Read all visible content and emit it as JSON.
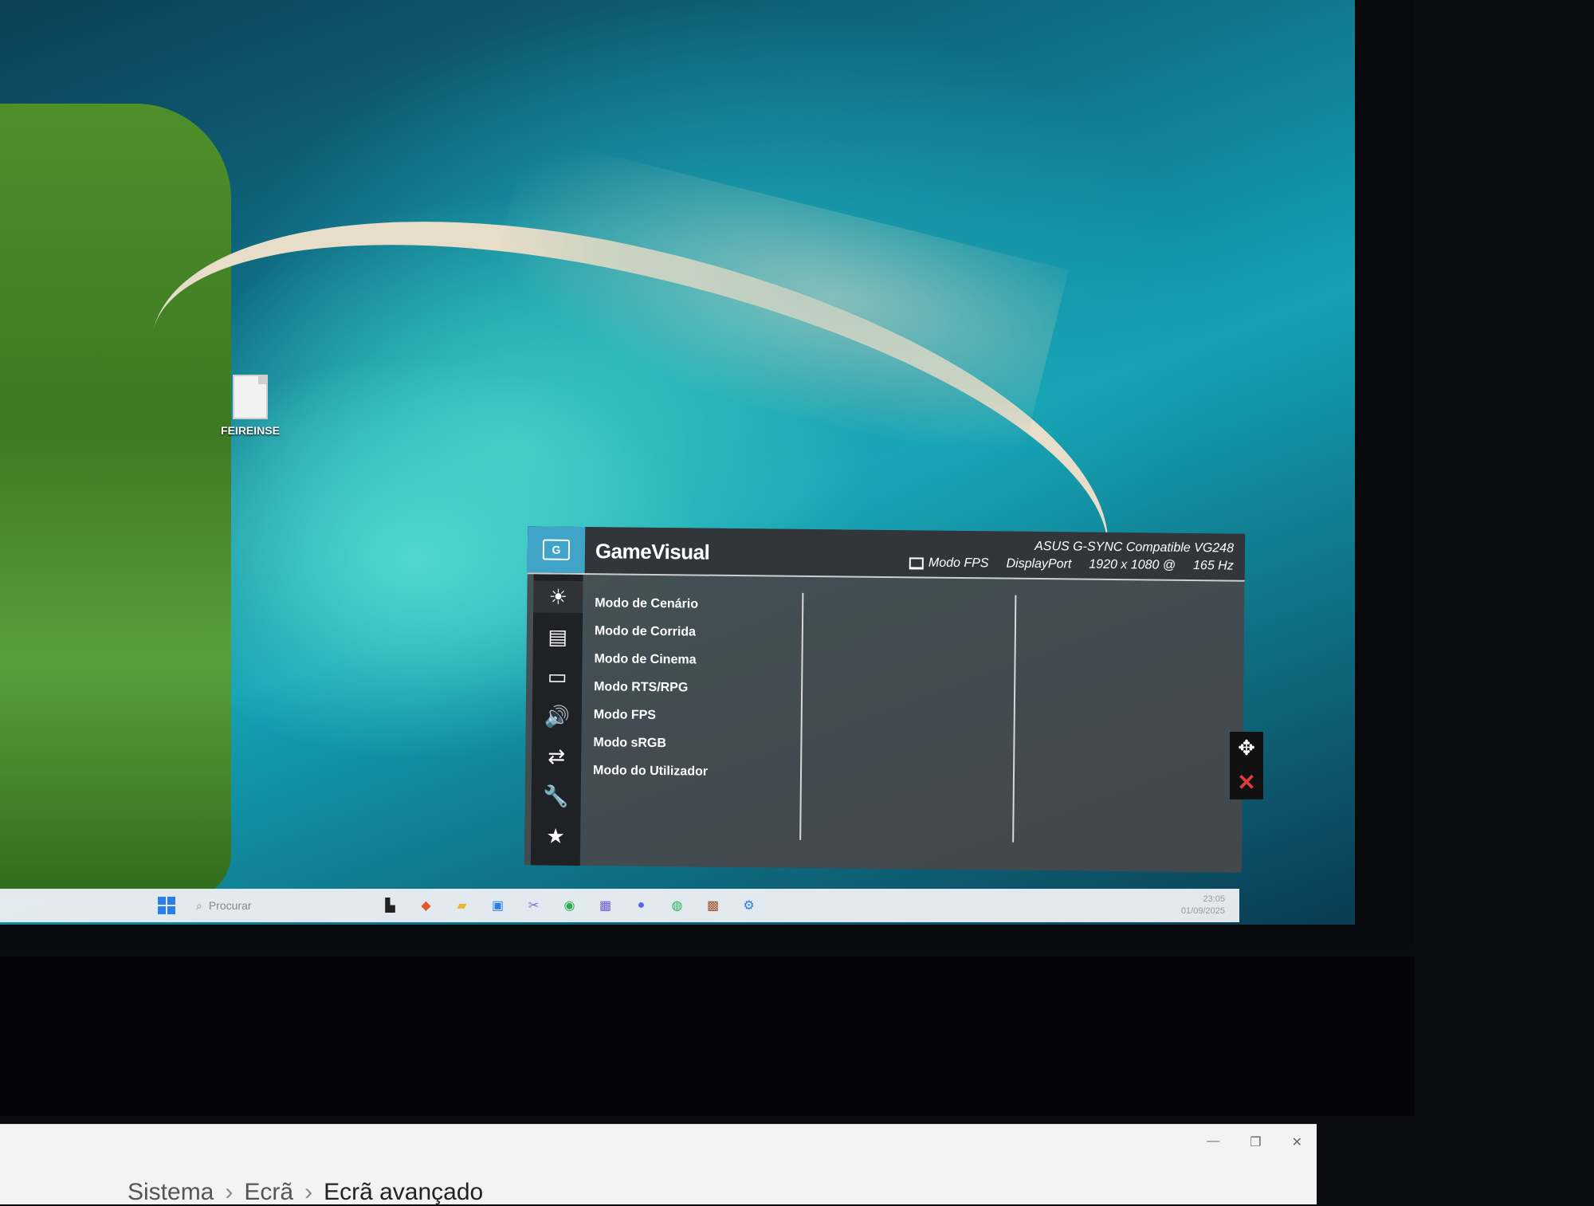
{
  "desktop": {
    "file_label": "FEIREINSE"
  },
  "osd": {
    "title": "GameVisual",
    "model": "ASUS G-SYNC Compatible VG248",
    "current_mode": "Modo FPS",
    "input": "DisplayPort",
    "resolution": "1920 x 1080 @",
    "refresh": "165 Hz",
    "sidebar_icons": [
      "brightness-icon",
      "color-icon",
      "image-icon",
      "sound-icon",
      "input-select-icon",
      "system-setup-icon",
      "my-favorite-icon"
    ],
    "menu_items": [
      "Modo de Cenário",
      "Modo de Corrida",
      "Modo de Cinema",
      "Modo RTS/RPG",
      "Modo FPS",
      "Modo sRGB",
      "Modo do Utilizador"
    ]
  },
  "taskbar": {
    "search_placeholder": "Procurar",
    "time": "23:05",
    "date": "01/09/2025"
  },
  "settings_window": {
    "breadcrumb": [
      "Sistema",
      "Ecrã",
      "Ecrã avançado"
    ]
  },
  "colors": {
    "osd_accent": "#3fa4c8",
    "close_red": "#e23b3b"
  }
}
